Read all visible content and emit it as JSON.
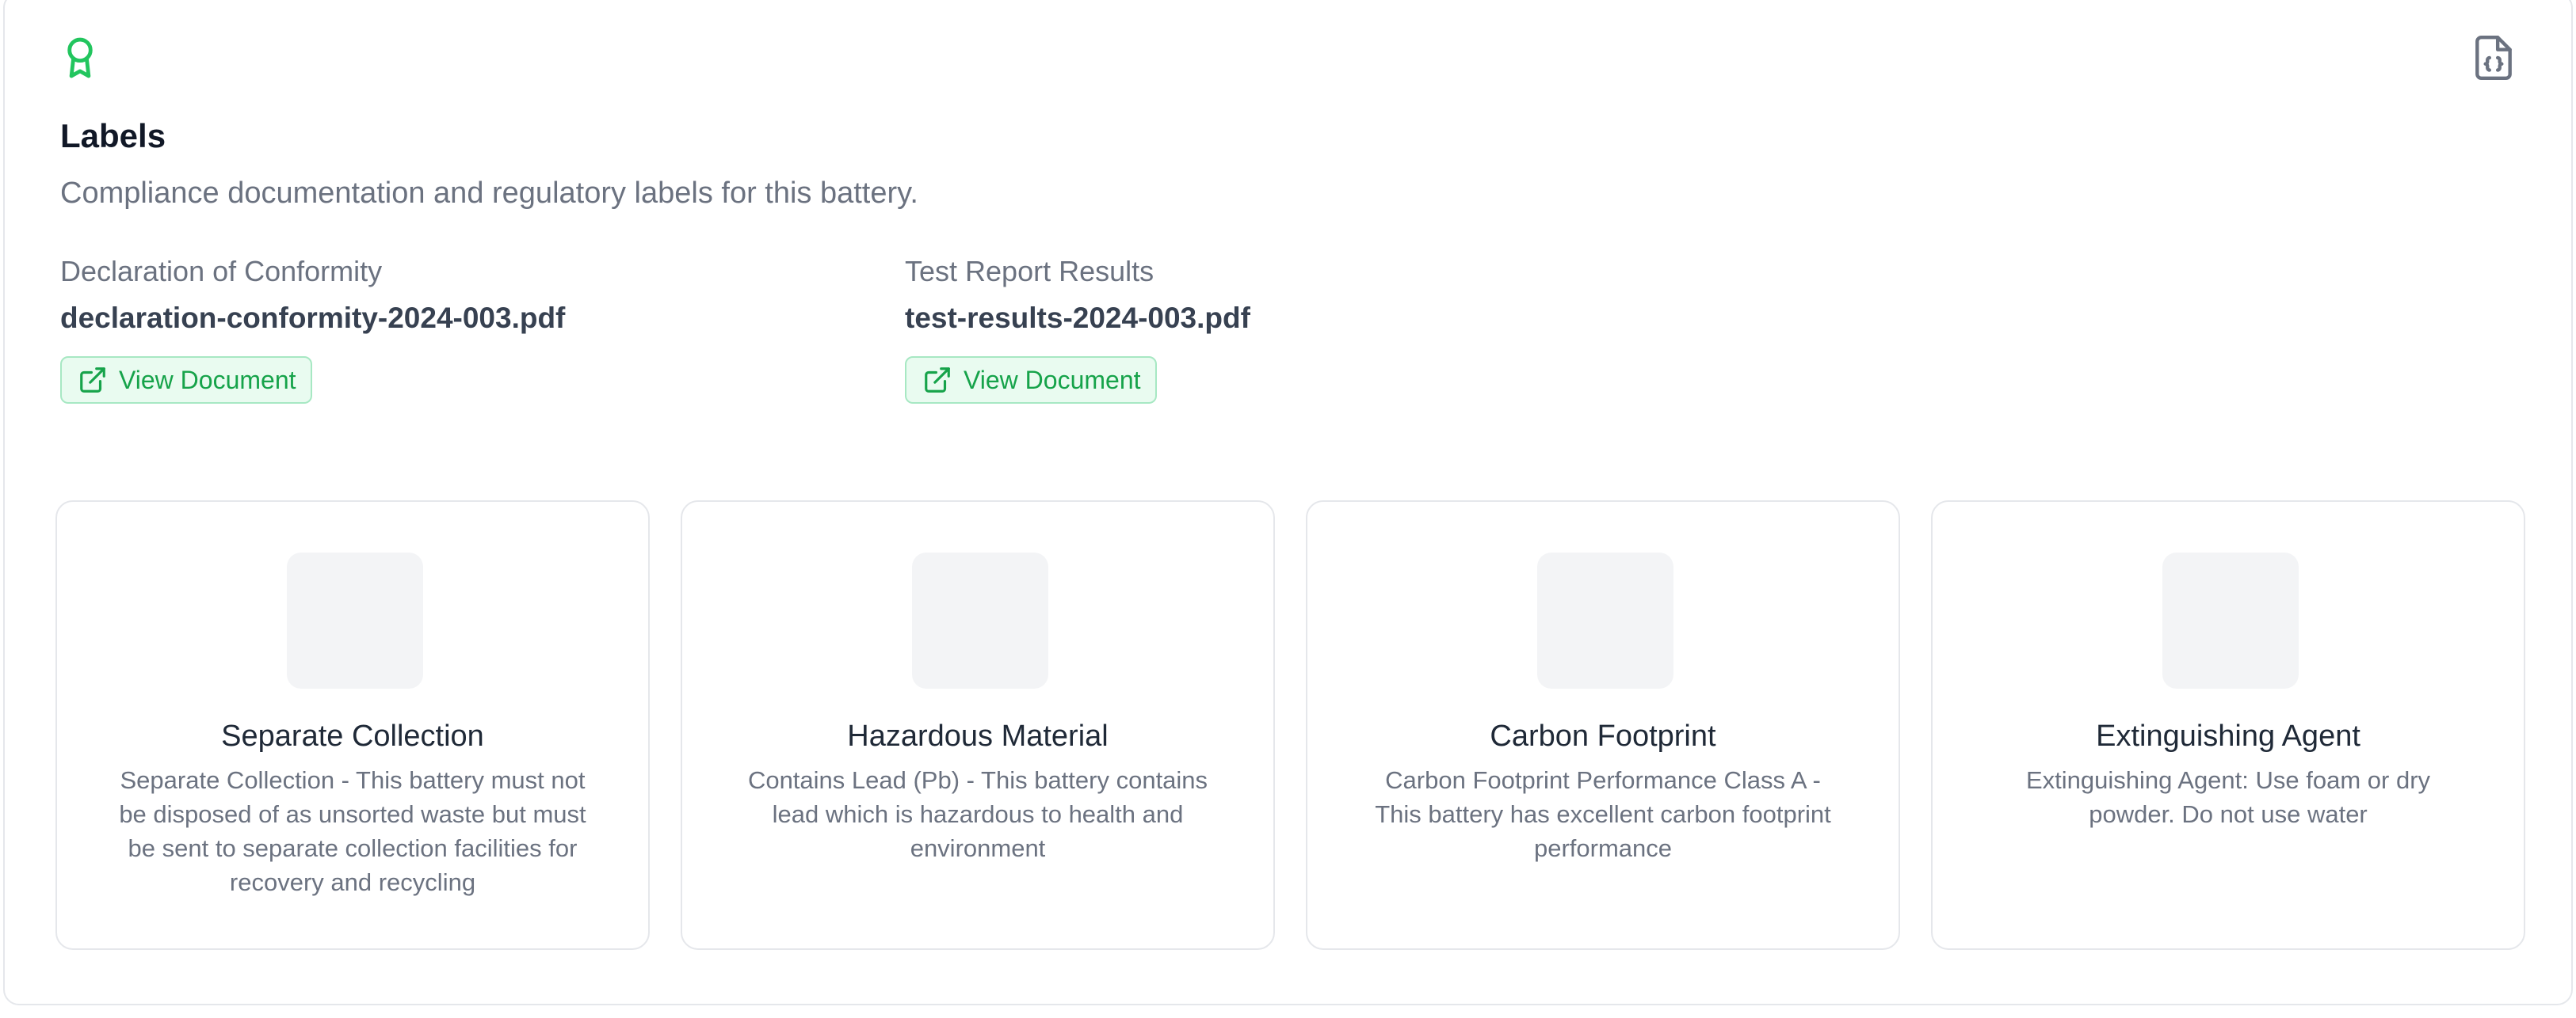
{
  "header": {
    "title": "Labels",
    "subtitle": "Compliance documentation and regulatory labels for this battery.",
    "badge_icon": "award-ribbon-icon",
    "export_icon": "file-json-icon",
    "accent_color": "#22c55e"
  },
  "documents": [
    {
      "label": "Declaration of Conformity",
      "filename": "declaration-conformity-2024-003.pdf",
      "button_label": "View Document",
      "button_icon": "external-link-icon"
    },
    {
      "label": "Test Report Results",
      "filename": "test-results-2024-003.pdf",
      "button_label": "View Document",
      "button_icon": "external-link-icon"
    }
  ],
  "labels": [
    {
      "title": "Separate Collection",
      "description": "Separate Collection - This battery must not be disposed of as unsorted waste but must be sent to separate collection facilities for recovery and recycling"
    },
    {
      "title": "Hazardous Material",
      "description": "Contains Lead (Pb) - This battery contains lead which is hazardous to health and environment"
    },
    {
      "title": "Carbon Footprint",
      "description": "Carbon Footprint Performance Class A - This battery has excellent carbon footprint performance"
    },
    {
      "title": "Extinguishing Agent",
      "description": "Extinguishing Agent: Use foam or dry powder. Do not use water"
    }
  ]
}
